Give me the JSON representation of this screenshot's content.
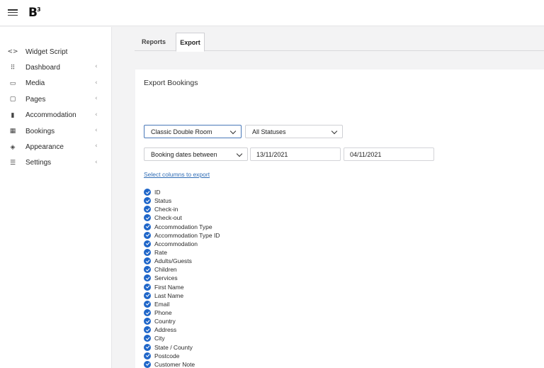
{
  "app": {
    "logo": "B",
    "logo_mark": "3"
  },
  "sidebar": {
    "items": [
      {
        "label": "Widget Script",
        "icon": "<>",
        "name": "widget-script",
        "icon_name": "code-icon",
        "chevron": false
      },
      {
        "label": "Dashboard",
        "icon": "⠿",
        "name": "dashboard",
        "icon_name": "grid-icon",
        "chevron": true
      },
      {
        "label": "Media",
        "icon": "▭",
        "name": "media",
        "icon_name": "image-icon",
        "chevron": true
      },
      {
        "label": "Pages",
        "icon": "▢",
        "name": "pages",
        "icon_name": "pages-icon",
        "chevron": true
      },
      {
        "label": "Accommodation",
        "icon": "▮",
        "name": "accommodation",
        "icon_name": "building-icon",
        "chevron": true
      },
      {
        "label": "Bookings",
        "icon": "▦",
        "name": "bookings",
        "icon_name": "calendar-icon",
        "chevron": true
      },
      {
        "label": "Appearance",
        "icon": "◈",
        "name": "appearance",
        "icon_name": "paint-bucket-icon",
        "chevron": true
      },
      {
        "label": "Settings",
        "icon": "☰",
        "name": "settings",
        "icon_name": "sliders-icon",
        "chevron": true
      }
    ],
    "chevron_glyph": "‹"
  },
  "tabs": {
    "reports": "Reports",
    "export": "Export"
  },
  "export": {
    "title": "Export Bookings",
    "room_select": "Classic Double Room",
    "status_select": "All Statuses",
    "date_mode_select": "Booking dates between",
    "date_from": "13/11/2021",
    "date_to": "04/11/2021",
    "columns_link": "Select columns to export",
    "columns": [
      "ID",
      "Status",
      "Check-in",
      "Check-out",
      "Accommodation Type",
      "Accommodation Type ID",
      "Accommodation",
      "Rate",
      "Adults/Guests",
      "Children",
      "Services",
      "First Name",
      "Last Name",
      "Email",
      "Phone",
      "Country",
      "Address",
      "City",
      "State / County",
      "Postcode",
      "Customer Note"
    ]
  },
  "colors": {
    "accent": "#1f66c9",
    "link": "#2f6cb5",
    "select_focus": "#4a79b8"
  }
}
